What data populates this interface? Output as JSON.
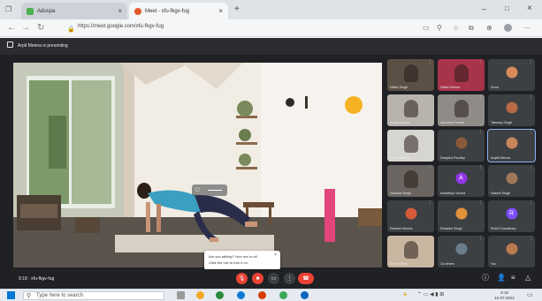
{
  "browser": {
    "tabs": [
      {
        "label": "Aduspa",
        "close": "×",
        "favicon_color": "#4caf50"
      },
      {
        "label": "Meet - xfu-fkgv-fug",
        "close": "×",
        "favicon_color": "#e05a2b"
      }
    ],
    "new_tab": "+",
    "window_controls": {
      "minimize": "–",
      "maximize": "□",
      "close": "×"
    },
    "url": "https://meet.google.com/xfu-fkgv-fug"
  },
  "meet": {
    "share_text": "Arpit Meena is presenting",
    "meeting_code": "9:18 · xfu-fkgv-fug",
    "toast": {
      "line1": "Are you talking? Your mic is off.",
      "line2": "Click the mic to turn it on.",
      "close": "×"
    },
    "participants": [
      {
        "name": "Nikita Singh",
        "kind": "video",
        "bg": "#5b5045"
      },
      {
        "name": "Nikita Meena",
        "kind": "video",
        "bg": "#a8344a"
      },
      {
        "name": "Sonu",
        "kind": "avatar",
        "bg": "#3c4043",
        "avatar_color": "#d88a5a"
      },
      {
        "name": "Anjali Meena",
        "kind": "video",
        "bg": "#b8b3ac"
      },
      {
        "name": "Vandana Pande",
        "kind": "video",
        "bg": "#8f8b86"
      },
      {
        "name": "Tanmay Singh",
        "kind": "avatar",
        "bg": "#3c4043",
        "avatar_color": "#b86a46"
      },
      {
        "name": "Preeti Meena",
        "kind": "video",
        "bg": "#d7d5d1"
      },
      {
        "name": "Deepika Pandey",
        "kind": "avatar",
        "bg": "#3c4043",
        "avatar_color": "#8a5a3c"
      },
      {
        "name": "Anjali Meena",
        "kind": "avatar",
        "bg": "#3c4043",
        "avatar_color": "#c7855a",
        "highlight": true
      },
      {
        "name": "Sahana Singh",
        "kind": "video",
        "bg": "#6a6560"
      },
      {
        "name": "Aaradhya Verma",
        "kind": "avatar",
        "bg": "#3c4043",
        "avatar_color": "#9334e6",
        "initial": "A"
      },
      {
        "name": "Sakshi Singh",
        "kind": "avatar",
        "bg": "#3c4043",
        "avatar_color": "#a0775a"
      },
      {
        "name": "Rashmi Meena",
        "kind": "avatar",
        "bg": "#3c4043",
        "avatar_color": "#d45a3a"
      },
      {
        "name": "Deepika Singh",
        "kind": "avatar",
        "bg": "#3c4043",
        "avatar_color": "#e0913a"
      },
      {
        "name": "Rohit Chaudhary",
        "kind": "avatar",
        "bg": "#3c4043",
        "avatar_color": "#7c4dff",
        "initial": "R"
      },
      {
        "name": "Anita Meena",
        "kind": "video",
        "bg": "#c9b6a0"
      },
      {
        "name": "13 others",
        "kind": "avatar",
        "bg": "#3c4043",
        "avatar_color": "#6b7c8a"
      },
      {
        "name": "You",
        "kind": "avatar",
        "bg": "#3c4043",
        "avatar_color": "#b97a50"
      }
    ]
  },
  "taskbar": {
    "search_placeholder": "Type here to search",
    "time": "9:18",
    "date": "12-07-2021"
  },
  "colors": {
    "meet_bg": "#202124",
    "end_call": "#ea4335",
    "mic_off": "#ea4335"
  }
}
